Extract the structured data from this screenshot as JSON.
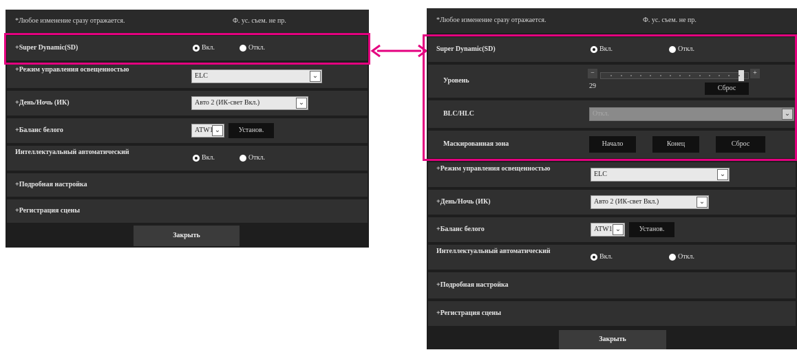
{
  "accent_color": "#e4007f",
  "left_panel": {
    "note": "*Любое изменение сразу отражается.",
    "legend": "Ф. ус. съем. не пр.",
    "super_dynamic": {
      "label": "+Super Dynamic(SD)",
      "on": "Вкл.",
      "off": "Откл.",
      "selected": "on"
    },
    "brightness_mode": {
      "label": "+Режим управления освещенностью",
      "value": "ELC"
    },
    "day_night": {
      "label": "+День/Ночь (ИК)",
      "value": "Авто 2 (ИК-свет Вкл.)"
    },
    "white_balance": {
      "label": "+Баланс белого",
      "value": "ATW1",
      "set_button": "Установ."
    },
    "intelligent_auto": {
      "label": "Интеллектуальный автоматический",
      "on": "Вкл.",
      "off": "Откл.",
      "selected": "on"
    },
    "detail_settings": "+Подробная настройка",
    "scene_registration": "+Регистрация сцены",
    "close_button": "Закрыть"
  },
  "right_panel": {
    "note": "*Любое изменение сразу отражается.",
    "legend": "Ф. ус. съем. не пр.",
    "super_dynamic": {
      "label": "Super Dynamic(SD)",
      "on": "Вкл.",
      "off": "Откл.",
      "selected": "on"
    },
    "level": {
      "label": "Уровень",
      "value": "29",
      "minus": "−",
      "plus": "+",
      "reset": "Сброс",
      "fraction": 0.97
    },
    "blc_hlc": {
      "label": "BLC/HLC",
      "value": "Откл."
    },
    "mask_area": {
      "label": "Маскированная зона",
      "start": "Начало",
      "end": "Конец",
      "reset": "Сброс"
    },
    "brightness_mode": {
      "label": "+Режим управления освещенностью",
      "value": "ELC"
    },
    "day_night": {
      "label": "+День/Ночь (ИК)",
      "value": "Авто 2 (ИК-свет Вкл.)"
    },
    "white_balance": {
      "label": "+Баланс белого",
      "value": "ATW1",
      "set_button": "Установ."
    },
    "intelligent_auto": {
      "label": "Интеллектуальный автоматический",
      "on": "Вкл.",
      "off": "Откл.",
      "selected": "on"
    },
    "detail_settings": "+Подробная настройка",
    "scene_registration": "+Регистрация сцены",
    "close_button": "Закрыть"
  }
}
